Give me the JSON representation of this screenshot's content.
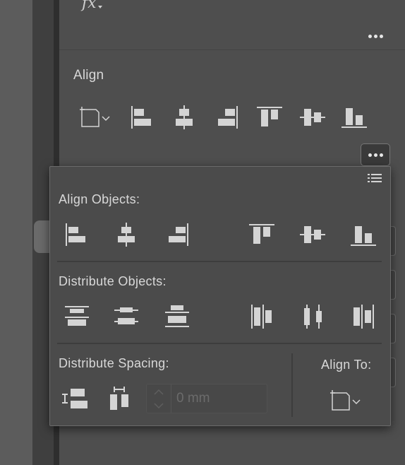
{
  "properties": {
    "fx_label": "fx",
    "align_section": {
      "title": "Align",
      "icons": [
        "align-to-selection-icon",
        "horizontal-align-left-icon",
        "horizontal-align-center-icon",
        "horizontal-align-right-icon",
        "vertical-align-top-icon",
        "vertical-align-center-icon",
        "vertical-align-bottom-icon"
      ]
    }
  },
  "popover": {
    "align_objects_label": "Align Objects:",
    "distribute_objects_label": "Distribute Objects:",
    "distribute_spacing_label": "Distribute Spacing:",
    "align_to_label": "Align To:",
    "spacing_placeholder": "0 mm",
    "align_objects_icons": [
      "horizontal-align-left-icon",
      "horizontal-align-center-icon",
      "horizontal-align-right-icon",
      "vertical-align-top-icon",
      "vertical-align-center-icon",
      "vertical-align-bottom-icon"
    ],
    "distribute_objects_icons": [
      "vertical-distribute-top-icon",
      "vertical-distribute-center-icon",
      "vertical-distribute-bottom-icon",
      "horizontal-distribute-left-icon",
      "horizontal-distribute-center-icon",
      "horizontal-distribute-right-icon"
    ],
    "distribute_spacing_icons": [
      "vertical-distribute-space-icon",
      "horizontal-distribute-space-icon"
    ]
  },
  "colors": {
    "panel_bg": "#4e4e4e",
    "popover_bg": "#4b4b4b",
    "icon_fill": "#d4d4d4",
    "text": "#d8d8d8"
  }
}
